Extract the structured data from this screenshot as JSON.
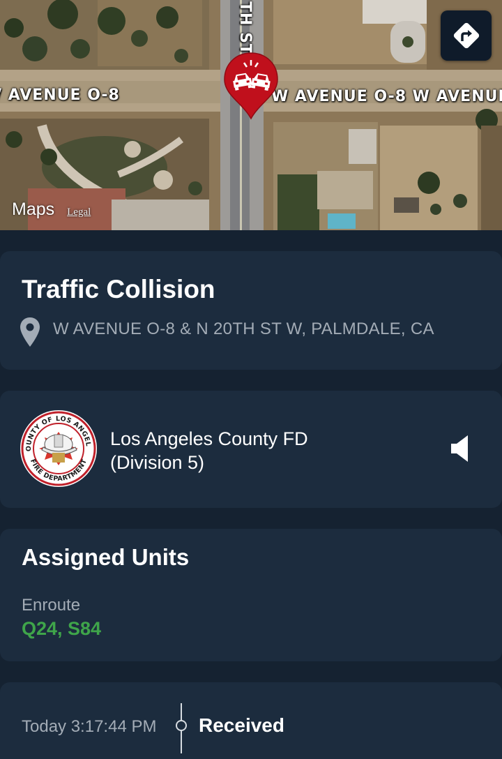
{
  "map": {
    "road_left": "/ AVENUE O-8",
    "road_right": "W AVENUE O-8  W AVENUE",
    "road_vertical": "TH ST",
    "maps_word": "Maps",
    "legal": "Legal",
    "pin_icon": "car-collision-icon",
    "directions_icon": "directions-icon"
  },
  "incident": {
    "title": "Traffic Collision",
    "location": "W AVENUE O-8 & N 20TH ST W, PALMDALE, CA",
    "location_icon": "location-pin-icon"
  },
  "agency": {
    "name_line1": "Los Angeles County FD",
    "name_line2": "(Division 5)",
    "seal_top": "COUNTY OF LOS ANGELES",
    "seal_bottom": "FIRE DEPARTMENT",
    "speaker_icon": "speaker-icon"
  },
  "units": {
    "title": "Assigned Units",
    "status": "Enroute",
    "list": "Q24, S84"
  },
  "timeline": {
    "time": "Today 3:17:44 PM",
    "event": "Received"
  },
  "colors": {
    "background": "#152231",
    "card": "#1c2c3e",
    "accent_green": "#3fa54a",
    "pin_red": "#c0101c"
  }
}
